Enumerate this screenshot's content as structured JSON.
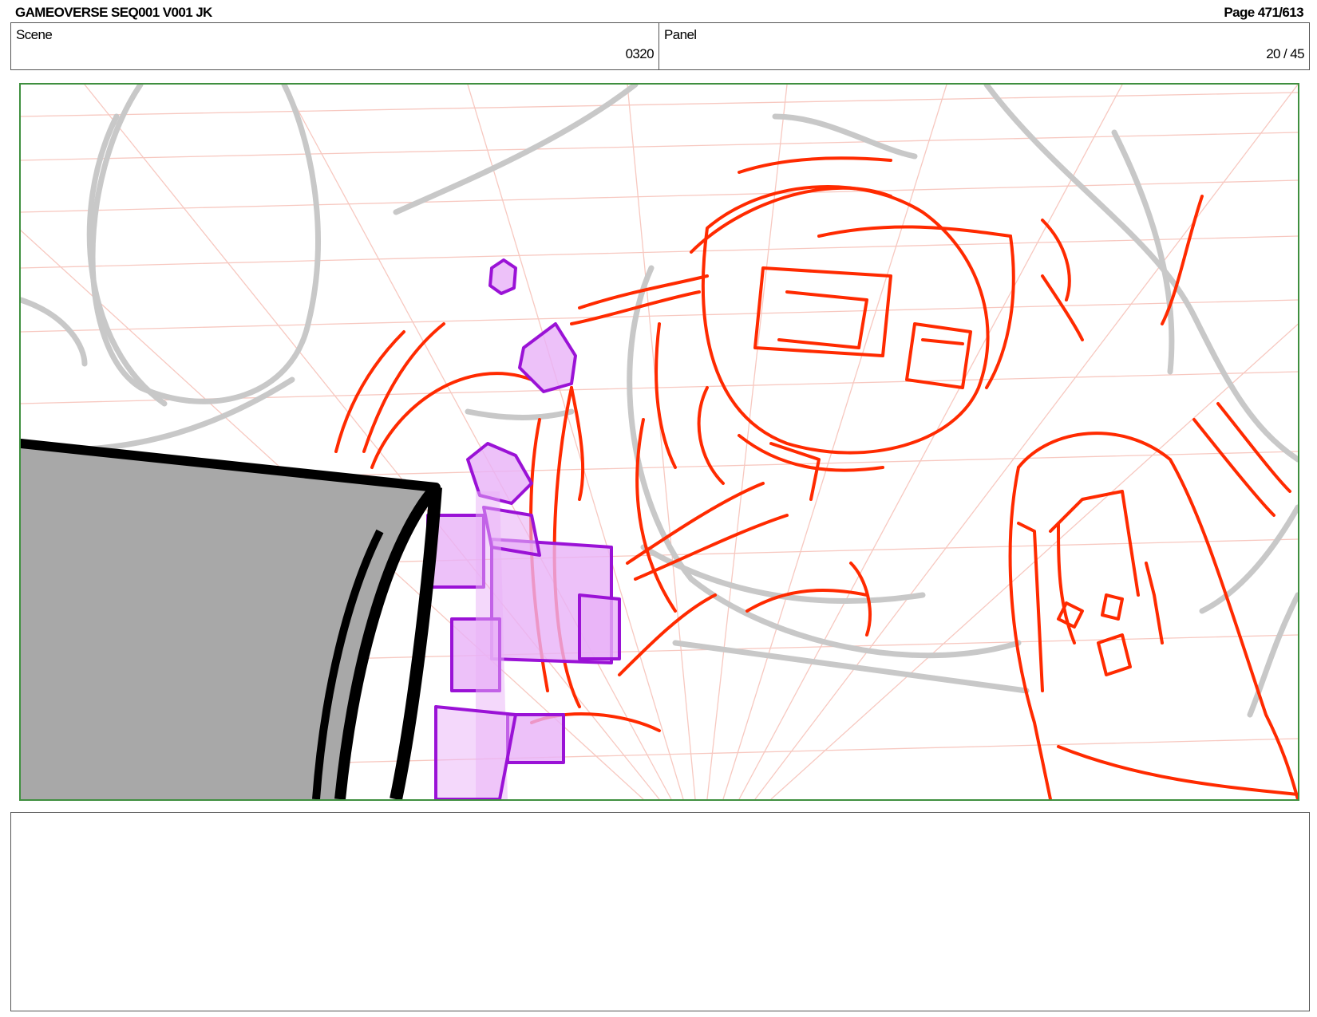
{
  "header": {
    "title": "GAMEOVERSE SEQ001 V001 JK",
    "page": "Page 471/613"
  },
  "scene": {
    "label": "Scene",
    "value": "0320"
  },
  "panel": {
    "label": "Panel",
    "value": "20 / 45"
  },
  "notes": {
    "text": ""
  },
  "colors": {
    "frame_border": "#3f8f3f",
    "rough_grey": "#c8c8c8",
    "perspective_grid": "#f7c8c0",
    "character_red": "#ff2a00",
    "cubes_purple": "#9a12d6",
    "cubes_fill": "#e9b2f7",
    "foreground_grey": "#a8a8a8"
  }
}
